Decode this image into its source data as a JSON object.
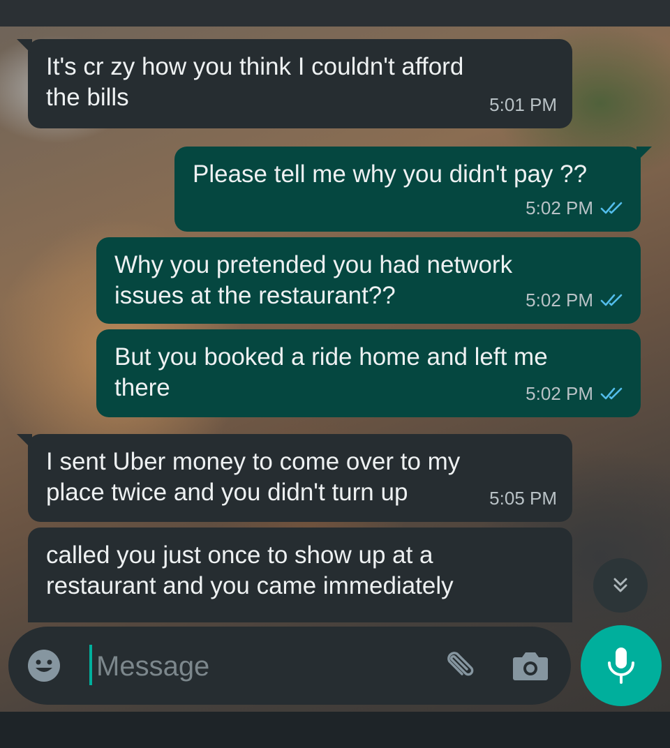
{
  "messages": [
    {
      "direction": "incoming",
      "text": "It's cr zy how you think I couldn't afford\nthe bills",
      "time": "5:01 PM"
    },
    {
      "direction": "outgoing",
      "text": "Please tell me why you didn't pay ??",
      "time": "5:02 PM",
      "status": "read"
    },
    {
      "direction": "outgoing",
      "text": "Why you pretended you had network\nissues at the restaurant??",
      "time": "5:02 PM",
      "status": "read"
    },
    {
      "direction": "outgoing",
      "text": "But you booked a ride home and left me\nthere",
      "time": "5:02 PM",
      "status": "read"
    },
    {
      "direction": "incoming",
      "text": "I sent Uber money to come over to my\nplace twice and you didn't turn up",
      "time": "5:05 PM"
    },
    {
      "direction": "incoming",
      "text": "called you just once to show up at a\nrestaurant and you came immediately",
      "time": ""
    }
  ],
  "composer": {
    "placeholder": "Message",
    "icons": [
      "emoji-icon",
      "attach-icon",
      "camera-icon",
      "mic-icon"
    ]
  },
  "scroll_button": {
    "icon": "double-chevron-down-icon"
  },
  "colors": {
    "incoming_bubble": "#262d31",
    "outgoing_bubble": "#054740",
    "accent": "#00af9c",
    "read_ticks": "#53bdeb"
  }
}
